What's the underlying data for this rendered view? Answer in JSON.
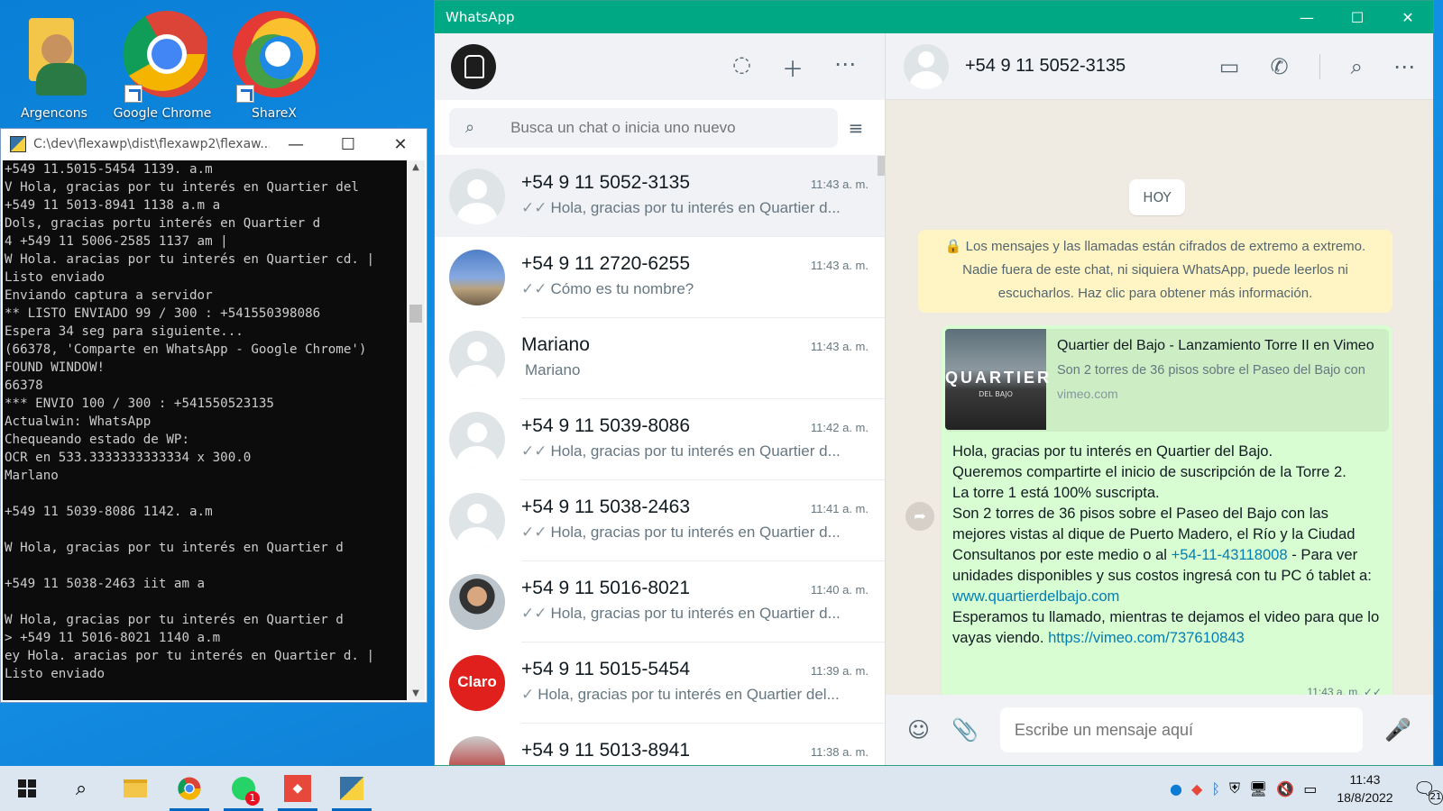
{
  "desktop": {
    "icons": [
      {
        "label": "Argencons",
        "icon": "folder-user-icon"
      },
      {
        "label": "Google Chrome",
        "icon": "chrome-icon"
      },
      {
        "label": "ShareX",
        "icon": "sharex-icon"
      }
    ]
  },
  "console": {
    "title": "C:\\dev\\flexawp\\dist\\flexawp2\\flexaw...",
    "lines": "+549 11.5015-5454 1139. a.m\nV Hola, gracias por tu interés en Quartier del\n+549 11 5013-8941 1138 a.m a\nDols, gracias portu interés en Quartier d\n4 +549 11 5006-2585 1137 am |\nW Hola. aracias por tu interés en Quartier cd. |\nListo enviado\nEnviando captura a servidor\n** LISTO ENVIADO 99 / 300 : +541550398086\nEspera 34 seg para siguiente...\n(66378, 'Comparte en WhatsApp - Google Chrome')\nFOUND WINDOW!\n66378\n*** ENVIO 100 / 300 : +541550523135\nActualwin: WhatsApp\nChequeando estado de WP:\nOCR en 533.3333333333334 x 300.0\nMarlano\n\n+549 11 5039-8086 1142. a.m\n\nW Hola, gracias por tu interés en Quartier d\n\n+549 11 5038-2463 iit am a\n\nW Hola, gracias por tu interés en Quartier d\n> +549 11 5016-8021 1140 a.m\ney Hola. aracias por tu interés en Quartier d. |\nListo enviado"
  },
  "whatsapp": {
    "window_title": "WhatsApp",
    "search_placeholder": "Busca un chat o inicia uno nuevo",
    "chats": [
      {
        "name": "+54 9 11 5052-3135",
        "time": "11:43 a. m.",
        "tick": "✓✓",
        "preview": "Hola, gracias por tu interés en Quartier d...",
        "avatar": "default"
      },
      {
        "name": "+54 9 11 2720-6255",
        "time": "11:43 a. m.",
        "tick": "✓✓",
        "preview": "Cómo es tu nombre?",
        "avatar": "photo1"
      },
      {
        "name": "Mariano",
        "time": "11:43 a. m.",
        "tick": "",
        "preview": "Mariano",
        "avatar": "default"
      },
      {
        "name": "+54 9 11 5039-8086",
        "time": "11:42 a. m.",
        "tick": "✓✓",
        "preview": "Hola, gracias por tu interés en Quartier d...",
        "avatar": "default"
      },
      {
        "name": "+54 9 11 5038-2463",
        "time": "11:41 a. m.",
        "tick": "✓✓",
        "preview": "Hola, gracias por tu interés en Quartier d...",
        "avatar": "default"
      },
      {
        "name": "+54 9 11 5016-8021",
        "time": "11:40 a. m.",
        "tick": "✓✓",
        "preview": "Hola, gracias por tu interés en Quartier d...",
        "avatar": "photo2"
      },
      {
        "name": "+54 9 11 5015-5454",
        "time": "11:39 a. m.",
        "tick": "✓",
        "preview": "Hola, gracias por tu interés en Quartier del...",
        "avatar": "claro",
        "avatar_text": "Claro"
      },
      {
        "name": "+54 9 11 5013-8941",
        "time": "11:38 a. m.",
        "tick": "",
        "preview": "",
        "avatar": "photo3"
      }
    ],
    "conversation": {
      "contact": "+54 9 11 5052-3135",
      "day_label": "HOY",
      "encryption_notice": "🔒 Los mensajes y las llamadas están cifrados de extremo a extremo. Nadie fuera de este chat, ni siquiera WhatsApp, puede leerlos ni escucharlos. Haz clic para obtener más información.",
      "link_preview": {
        "title": "Quartier del Bajo - Lanzamiento Torre II en Vimeo",
        "description": "Son 2 torres de 36 pisos sobre el Paseo del Bajo con",
        "domain": "vimeo.com",
        "thumb_text": "QUARTIER",
        "thumb_sub": "DEL BAJO"
      },
      "message_before_phone": "Hola, gracias por tu interés en Quartier del Bajo.\nQueremos compartirte el inicio de suscripción de la Torre 2.\nLa torre 1 está 100% suscripta.\nSon 2 torres de 36 pisos sobre el Paseo del Bajo con las mejores vistas al dique de Puerto Madero, el Río y la Ciudad\nConsultanos por este medio o al ",
      "phone_link": "+54-11-43118008",
      "message_mid": " - Para ver unidades disponibles y sus costos ingresá con tu PC ó tablet a: ",
      "web_link": "www.quartierdelbajo.com",
      "message_after": "\nEsperamos tu llamado, mientras te dejamos el video para que lo vayas viendo. ",
      "video_link": "https://vimeo.com/737610843",
      "message_time": "11:43 a. m. ✓✓",
      "composer_placeholder": "Escribe un mensaje aquí"
    }
  },
  "taskbar": {
    "time": "11:43",
    "date": "18/8/2022",
    "whatsapp_badge": "1",
    "notification_count": "21"
  }
}
